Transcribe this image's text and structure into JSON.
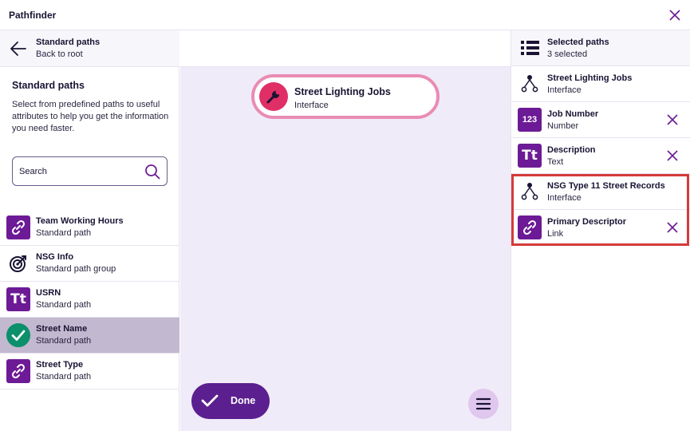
{
  "app": {
    "title": "Pathfinder"
  },
  "left": {
    "back": {
      "title": "Standard paths",
      "subtitle": "Back to root"
    },
    "section_title": "Standard paths",
    "section_desc": "Select from predefined paths to useful attributes to help you get the information you need faster.",
    "search": {
      "placeholder": "Search",
      "value": ""
    },
    "items": [
      {
        "label": "Team Working Hours",
        "sub": "Standard path",
        "icon": "link-icon"
      },
      {
        "label": "NSG Info",
        "sub": "Standard path group",
        "icon": "target-icon"
      },
      {
        "label": "USRN",
        "sub": "Standard path",
        "icon": "text-icon",
        "badge": "Tt"
      },
      {
        "label": "Street Name",
        "sub": "Standard path",
        "icon": "check-icon",
        "selected": true
      },
      {
        "label": "Street Type",
        "sub": "Standard path",
        "icon": "link-icon"
      }
    ]
  },
  "center": {
    "node": {
      "title": "Street Lighting Jobs",
      "subtitle": "Interface",
      "icon": "wrench-icon"
    },
    "done_label": "Done"
  },
  "right": {
    "header": {
      "title": "Selected paths",
      "subtitle": "3 selected",
      "icon": "list-icon"
    },
    "items": [
      {
        "label": "Street Lighting Jobs",
        "sub": "Interface",
        "icon": "interface-icon",
        "removable": false
      },
      {
        "label": "Job Number",
        "sub": "Number",
        "icon": "number-icon",
        "badge": "123",
        "removable": true
      },
      {
        "label": "Description",
        "sub": "Text",
        "icon": "text-icon",
        "badge": "Tt",
        "removable": true
      },
      {
        "label": "NSG Type 11 Street Records",
        "sub": "Interface",
        "icon": "interface-icon",
        "removable": false
      },
      {
        "label": "Primary Descriptor",
        "sub": "Link",
        "icon": "link-icon",
        "removable": true
      }
    ]
  },
  "colors": {
    "accent": "#6d1a96",
    "done": "#5b1f8f",
    "node_ring": "#e98cb4",
    "node_icon": "#e02e67",
    "selected_row": "#c2b8cf",
    "check": "#0c8f6b",
    "highlight": "#d43a3a"
  }
}
